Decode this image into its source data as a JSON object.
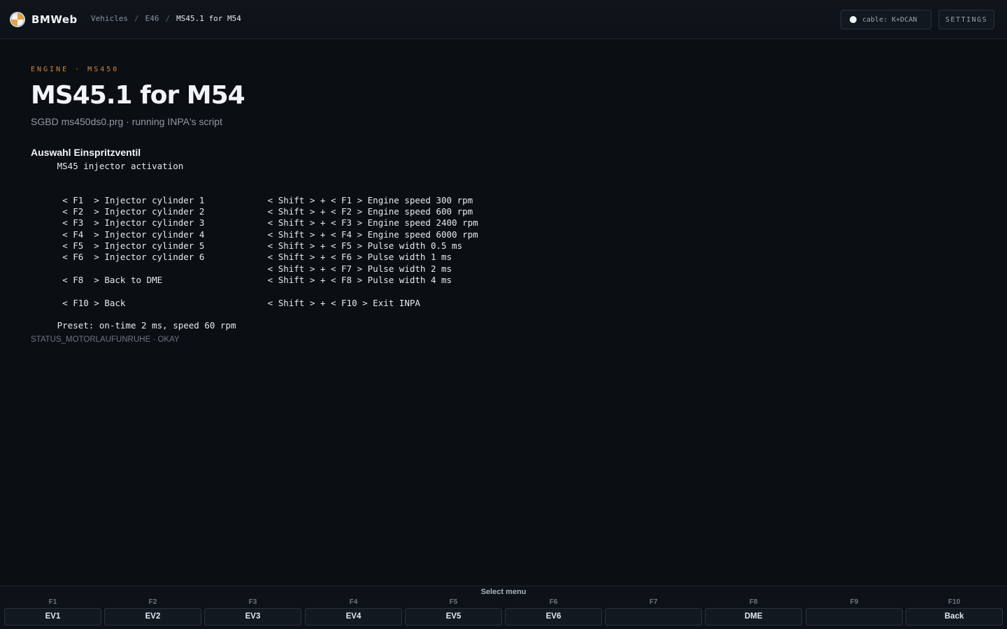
{
  "header": {
    "brand": "BMWeb",
    "breadcrumb": [
      "Vehicles",
      "E46",
      "MS45.1 for M54"
    ],
    "cable_label": "cable: K+DCAN",
    "settings_label": "SETTINGS"
  },
  "main": {
    "eyebrow": "ENGINE · MS450",
    "title": "MS45.1 for M54",
    "subtitle": "SGBD ms450ds0.prg · running INPA's script",
    "section_title": "Auswahl Einspritzventil",
    "screen_lines": [
      "     MS45 injector activation",
      "",
      "",
      "      < F1  > Injector cylinder 1            < Shift > + < F1 > Engine speed 300 rpm",
      "      < F2  > Injector cylinder 2            < Shift > + < F2 > Engine speed 600 rpm",
      "      < F3  > Injector cylinder 3            < Shift > + < F3 > Engine speed 2400 rpm",
      "      < F4  > Injector cylinder 4            < Shift > + < F4 > Engine speed 6000 rpm",
      "      < F5  > Injector cylinder 5            < Shift > + < F5 > Pulse width 0.5 ms",
      "      < F6  > Injector cylinder 6            < Shift > + < F6 > Pulse width 1 ms",
      "                                             < Shift > + < F7 > Pulse width 2 ms",
      "      < F8  > Back to DME                    < Shift > + < F8 > Pulse width 4 ms",
      "",
      "      < F10 > Back                           < Shift > + < F10 > Exit INPA",
      "",
      "     Preset: on-time 2 ms, speed 60 rpm"
    ],
    "status": "STATUS_MOTORLAUFUNRUHE · OKAY"
  },
  "fbar": {
    "title": "Select menu",
    "keys": [
      {
        "key": "F1",
        "label": "EV1"
      },
      {
        "key": "F2",
        "label": "EV2"
      },
      {
        "key": "F3",
        "label": "EV3"
      },
      {
        "key": "F4",
        "label": "EV4"
      },
      {
        "key": "F5",
        "label": "EV5"
      },
      {
        "key": "F6",
        "label": "EV6"
      },
      {
        "key": "F7",
        "label": ""
      },
      {
        "key": "F8",
        "label": "DME"
      },
      {
        "key": "F9",
        "label": ""
      },
      {
        "key": "F10",
        "label": "Back"
      }
    ]
  },
  "colors": {
    "background": "#0b0f14",
    "accent": "#d5853a",
    "text": "#e6e9ee",
    "muted": "#9099a3"
  }
}
